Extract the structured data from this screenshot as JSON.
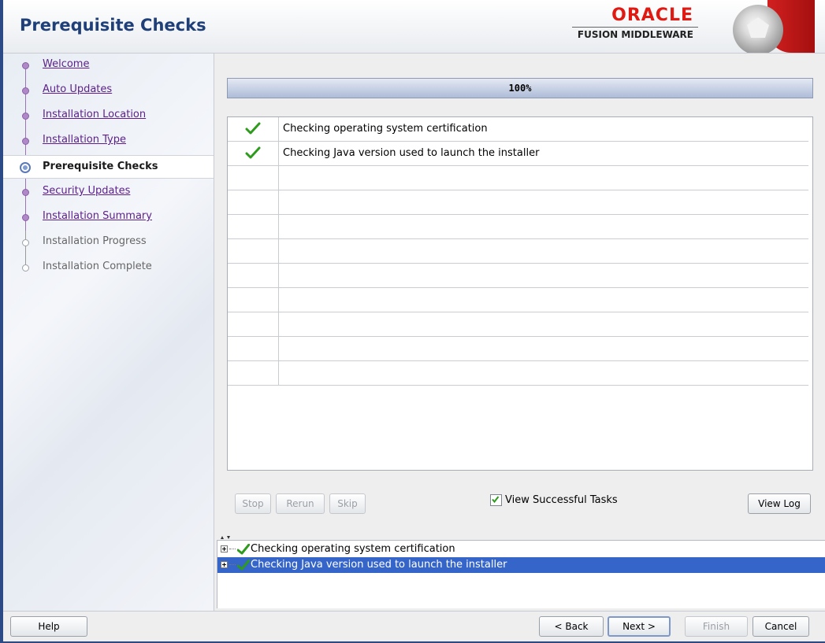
{
  "header": {
    "title": "Prerequisite Checks",
    "logo_oracle": "ORACLE",
    "logo_product": "FUSION MIDDLEWARE"
  },
  "sidebar": {
    "items": [
      {
        "label": "Welcome",
        "state": "done"
      },
      {
        "label": "Auto Updates",
        "state": "done"
      },
      {
        "label": "Installation Location",
        "state": "done"
      },
      {
        "label": "Installation Type",
        "state": "done"
      },
      {
        "label": "Prerequisite Checks",
        "state": "current"
      },
      {
        "label": "Security Updates",
        "state": "done"
      },
      {
        "label": "Installation Summary",
        "state": "done"
      },
      {
        "label": "Installation Progress",
        "state": "future"
      },
      {
        "label": "Installation Complete",
        "state": "future"
      }
    ]
  },
  "progress": {
    "text": "100%",
    "value": 1.0
  },
  "tasks": [
    {
      "text": "Checking operating system certification",
      "status": "success"
    },
    {
      "text": "Checking Java version used to launch the installer",
      "status": "success"
    },
    {
      "text": "",
      "status": ""
    },
    {
      "text": "",
      "status": ""
    },
    {
      "text": "",
      "status": ""
    },
    {
      "text": "",
      "status": ""
    },
    {
      "text": "",
      "status": ""
    },
    {
      "text": "",
      "status": ""
    },
    {
      "text": "",
      "status": ""
    },
    {
      "text": "",
      "status": ""
    },
    {
      "text": "",
      "status": ""
    }
  ],
  "task_buttons": {
    "stop": "Stop",
    "rerun": "Rerun",
    "skip": "Skip",
    "view_successful": "View Successful Tasks",
    "view_successful_checked": true,
    "view_log": "View Log"
  },
  "log": [
    {
      "text": "Checking operating system certification",
      "selected": false
    },
    {
      "text": "Checking Java version used to launch the installer",
      "selected": true
    }
  ],
  "footer": {
    "help": "Help",
    "back": "< Back",
    "next": "Next >",
    "finish": "Finish",
    "cancel": "Cancel"
  },
  "colors": {
    "title": "#1f3f78",
    "oracle_red": "#e01a12",
    "link_visited": "#5a1f8a",
    "selection": "#3565c9",
    "check_green": "#2e9a1e"
  }
}
